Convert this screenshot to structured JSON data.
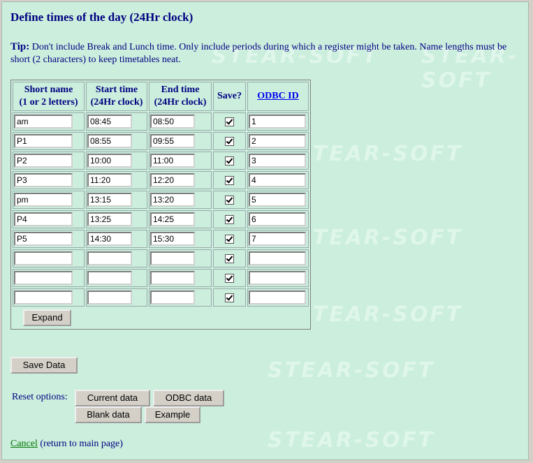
{
  "page": {
    "title": "Define times of the day (24Hr clock)",
    "tip_label": "Tip:",
    "tip_text": "Don't include Break and Lunch time. Only include periods during which a register might be taken. Name lengths must be short (2 characters) to keep timetables neat.",
    "watermark": "STEAR-SOFT"
  },
  "table": {
    "headers": {
      "short_name_1": "Short name",
      "short_name_2": "(1 or 2 letters)",
      "start_1": "Start time",
      "start_2": "(24Hr clock)",
      "end_1": "End time",
      "end_2": "(24Hr clock)",
      "save": "Save?",
      "odbc": "ODBC ID"
    },
    "rows": [
      {
        "name": "am",
        "start": "08:45",
        "end": "08:50",
        "save": true,
        "odbc": "1"
      },
      {
        "name": "P1",
        "start": "08:55",
        "end": "09:55",
        "save": true,
        "odbc": "2"
      },
      {
        "name": "P2",
        "start": "10:00",
        "end": "11:00",
        "save": true,
        "odbc": "3"
      },
      {
        "name": "P3",
        "start": "11:20",
        "end": "12:20",
        "save": true,
        "odbc": "4"
      },
      {
        "name": "pm",
        "start": "13:15",
        "end": "13:20",
        "save": true,
        "odbc": "5"
      },
      {
        "name": "P4",
        "start": "13:25",
        "end": "14:25",
        "save": true,
        "odbc": "6"
      },
      {
        "name": "P5",
        "start": "14:30",
        "end": "15:30",
        "save": true,
        "odbc": "7"
      },
      {
        "name": "",
        "start": "",
        "end": "",
        "save": true,
        "odbc": ""
      },
      {
        "name": "",
        "start": "",
        "end": "",
        "save": true,
        "odbc": ""
      },
      {
        "name": "",
        "start": "",
        "end": "",
        "save": true,
        "odbc": ""
      }
    ],
    "expand_label": "Expand"
  },
  "actions": {
    "save_label": "Save Data",
    "reset_label": "Reset options:",
    "current_label": "Current data",
    "odbc_label": "ODBC data",
    "blank_label": "Blank data",
    "example_label": "Example",
    "cancel_label": "Cancel",
    "cancel_note": "(return to main page)"
  }
}
